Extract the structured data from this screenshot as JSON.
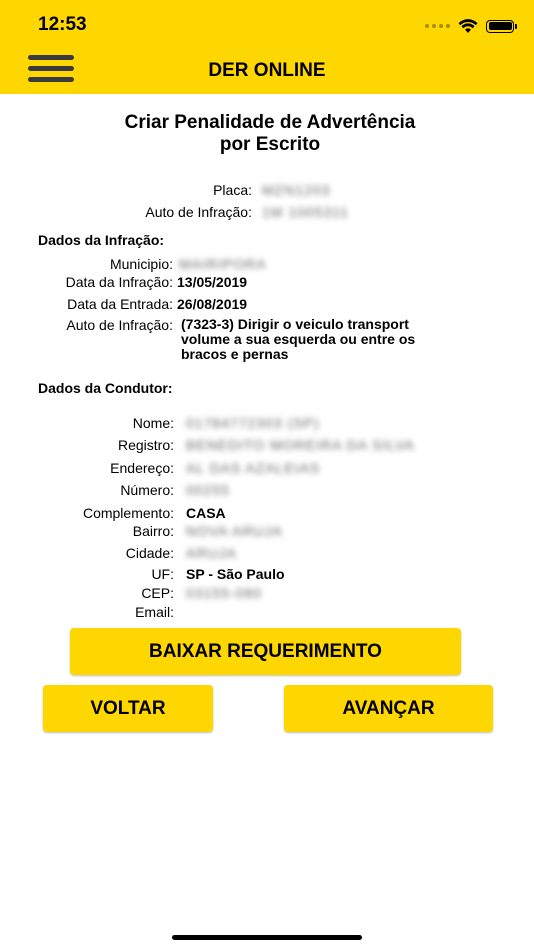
{
  "status_bar": {
    "time": "12:53"
  },
  "header": {
    "title": "DER ONLINE",
    "menu_icon": "hamburger-menu-icon"
  },
  "page_title_line1": "Criar Penalidade de Advertência",
  "page_title_line2": "por Escrito",
  "top_info": [
    {
      "label": "Placa:",
      "value": "MZN1203"
    },
    {
      "label": "Auto de Infração:",
      "value": "1M 1005311"
    }
  ],
  "infraction_section": {
    "title": "Dados da Infração:",
    "municipio_label": "Municipio:",
    "municipio_value": "MAIRIPORA",
    "data_infracao_label": "Data da Infração:",
    "data_infracao_value": "13/05/2019",
    "data_entrada_label": "Data da Entrada:",
    "data_entrada_value": "26/08/2019",
    "auto_label": "Auto de Infração:",
    "auto_line1": "(7323-3) Dirigir o veiculo transport",
    "auto_line2": "volume a sua esquerda ou entre os",
    "auto_line3": "bracos e pernas"
  },
  "driver_section": {
    "title": "Dados da Condutor:",
    "nome_label": "Nome:",
    "nome_value": "01784772303 (SP)",
    "registro_label": "Registro:",
    "registro_value": "BENEDITO MOREIRA DA SILVA",
    "endereco_label": "Endereço:",
    "endereco_value": "AL DAS AZALEIAS",
    "numero_label": "Número:",
    "numero_value": "00255",
    "complemento_label": "Complemento:",
    "complemento_value": "CASA",
    "bairro_label": "Bairro:",
    "bairro_value": "NOVA ARUJA",
    "cidade_label": "Cidade:",
    "cidade_value": "ARUJA",
    "uf_label": "UF:",
    "uf_value": "SP - São Paulo",
    "cep_label": "CEP:",
    "cep_value": "03155-080",
    "email_label": "Email:"
  },
  "buttons": {
    "download": "BAIXAR REQUERIMENTO",
    "back": "VOLTAR",
    "next": "AVANÇAR"
  },
  "colors": {
    "accent": "#FED700"
  }
}
